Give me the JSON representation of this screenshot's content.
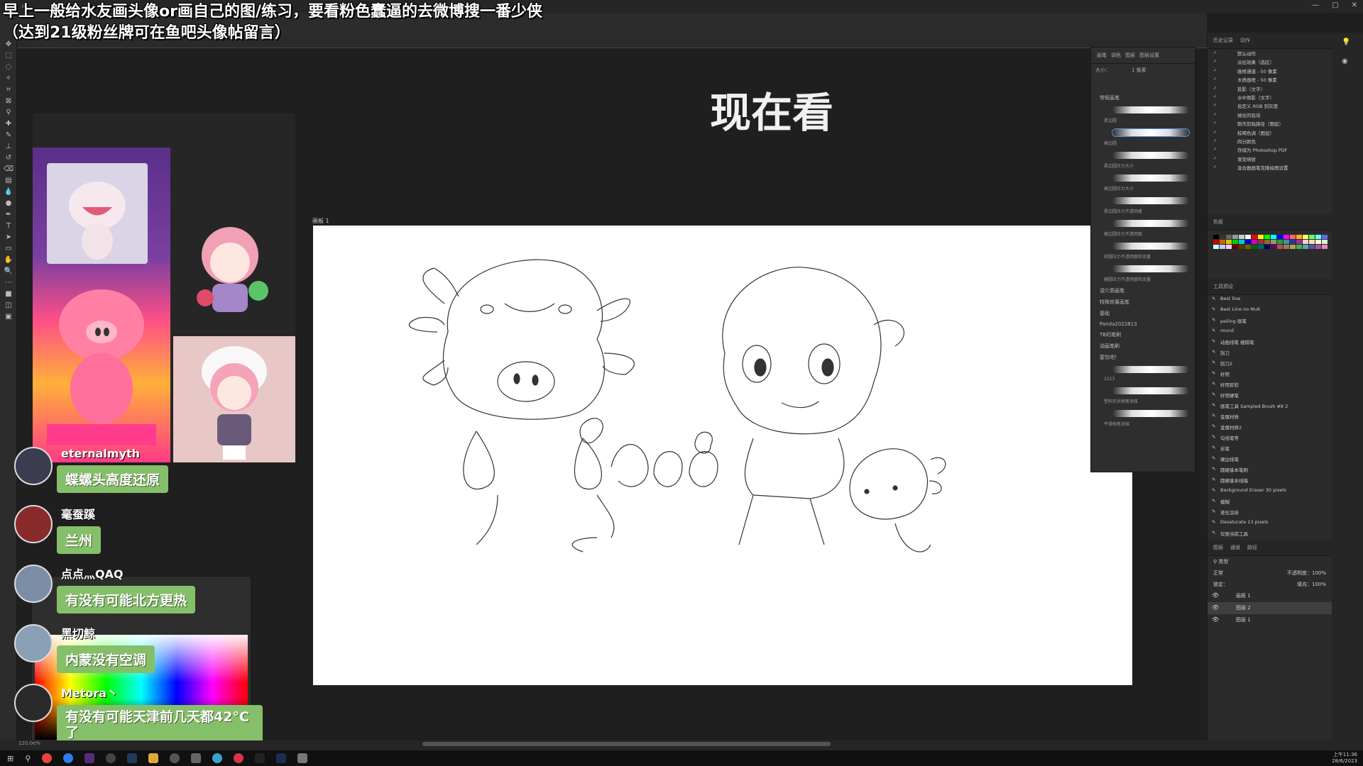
{
  "stream_overlay": {
    "line1": "早上一般给水友画头像or画自己的图/练习，要看粉色蠢逼的去微博搜一番少侠",
    "line2": "（达到21级粉丝牌可在鱼吧头像帖留言）",
    "center_title": "现在看"
  },
  "document": {
    "tab_label": "画板 1",
    "zoom": "120.0e%"
  },
  "brush_panel": {
    "tabs": [
      "画笔",
      "调色",
      "图层",
      "图层设置"
    ],
    "size_label": "大小：",
    "size_value": "1 像素",
    "sections": [
      {
        "name": "常规画笔",
        "items": [
          "柔边圆",
          "硬边圆",
          "柔边圆压力大小",
          "硬边圆压力大小",
          "柔边圆压力不透明度",
          "硬边圆压力不透明度",
          "软圆压力不透明度和流量",
          "硬圆压力不透明度和流量"
        ]
      },
      {
        "name": "湿介质画笔",
        "items": []
      },
      {
        "name": "特殊效果画笔",
        "items": []
      },
      {
        "name": "基础",
        "items": []
      },
      {
        "name": "Panda2022813",
        "items": []
      },
      {
        "name": "TB的笔刷",
        "items": []
      },
      {
        "name": "油画笔刷",
        "items": []
      },
      {
        "name": "宴饮吧！",
        "items": [
          "3223",
          "塑料形状刷笔涂抹",
          "平滑刷笔涂抹"
        ]
      }
    ]
  },
  "right_panels": {
    "history_tabs": [
      "历史记录",
      "动作"
    ],
    "actions": [
      "默认动作",
      "淡出效果（选区）",
      "画框通道 - 50 像素",
      "木质画框 - 50 像素",
      "投影（文字）",
      "水中倒影（文字）",
      "自定义 RGB 到灰度",
      "熔化的铅块",
      "制作剪贴路径（图层）",
      "棕褐色调（图层）",
      "四分颜色",
      "存储为 Photoshop PDF",
      "渐变映射",
      "混合器画笔克隆绘图设置"
    ],
    "swatches_title": "色板",
    "tool_presets_title": "工具预设",
    "tool_presets": [
      "Best line",
      "Best Line no Mult",
      "peiling 画笔",
      "round",
      "动画线笔 细隔笔",
      "刮刀",
      "刮刀2",
      "好用",
      "好用软软",
      "好用硬笔",
      "画笔工具 Sampled Brush #8 2",
      "金属材质",
      "金属材质2",
      "勾线笔等",
      "炭笔",
      "硬边线笔",
      "圆硬基本笔刷",
      "圆硬基本线稿",
      "Background Eraser 30 pixels",
      "模糊",
      "液化涂抹",
      "Desaturate 13 pixels",
      "仅限当前工具"
    ],
    "layers_tabs": [
      "图层",
      "通道",
      "路径"
    ],
    "layer_filter": "类型",
    "blend_mode": "正常",
    "opacity": "不透明度：100%",
    "lock_label": "锁定：",
    "fill": "填充：100%",
    "layers": [
      "画板 1",
      "图层 2",
      "图层 1"
    ]
  },
  "chat": [
    {
      "name": "eternalmyth",
      "message": "蝶螺头高度还原",
      "avatar_color": "#3c3c50"
    },
    {
      "name": "毫蚕蹊",
      "message": "兰州",
      "avatar_color": "#8a2b2b"
    },
    {
      "name": "点点灬QAQ",
      "message": "有没有可能北方更热",
      "avatar_color": "#7b8ea6"
    },
    {
      "name": "黑切鲸",
      "message": "内蒙没有空调",
      "avatar_color": "#8aa0b6"
    },
    {
      "name": "Metora丶",
      "message": "有没有可能天津前几天都42°C了",
      "avatar_color": "#2a2a2a"
    }
  ],
  "taskbar": {
    "time": "上午11:36",
    "date": "28/6/2023"
  },
  "colors": {
    "app_bg": "#1e1e1e",
    "panel": "#2b2b2b",
    "chat_bubble": "#86bf6a",
    "canvas": "#ffffff"
  }
}
